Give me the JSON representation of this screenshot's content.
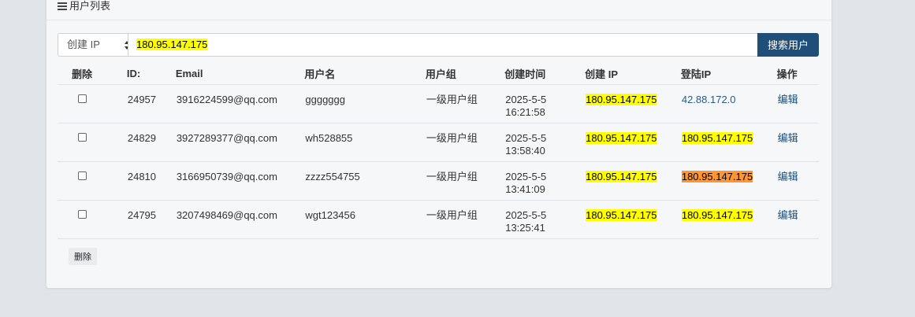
{
  "panel": {
    "title": "用户列表",
    "icon": "list-icon"
  },
  "search": {
    "field_selected": "创建 IP",
    "value": "180.95.147.175",
    "button_label": "搜索用户"
  },
  "table": {
    "headers": [
      "删除",
      "ID:",
      "Email",
      "用户名",
      "用户组",
      "创建时间",
      "创建 IP",
      "登陆IP",
      "操作"
    ],
    "rows": [
      {
        "id": "24957",
        "email": "3916224599@qq.com",
        "username": "ggggggg",
        "group": "一级用户组",
        "date": "2025-5-5",
        "time": "16:21:58",
        "create_ip": "180.95.147.175",
        "login_ip": "42.88.172.0",
        "login_ip_style": "link",
        "op": "编辑"
      },
      {
        "id": "24829",
        "email": "3927289377@qq.com",
        "username": "wh528855",
        "group": "一级用户组",
        "date": "2025-5-5",
        "time": "13:58:40",
        "create_ip": "180.95.147.175",
        "login_ip": "180.95.147.175",
        "login_ip_style": "yellow",
        "op": "编辑"
      },
      {
        "id": "24810",
        "email": "3166950739@qq.com",
        "username": "zzzz554755",
        "group": "一级用户组",
        "date": "2025-5-5",
        "time": "13:41:09",
        "create_ip": "180.95.147.175",
        "login_ip": "180.95.147.175",
        "login_ip_style": "orange",
        "op": "编辑"
      },
      {
        "id": "24795",
        "email": "3207498469@qq.com",
        "username": "wgt123456",
        "group": "一级用户组",
        "date": "2025-5-5",
        "time": "13:25:41",
        "create_ip": "180.95.147.175",
        "login_ip": "180.95.147.175",
        "login_ip_style": "yellow",
        "op": "编辑"
      }
    ]
  },
  "footer": {
    "delete_label": "删除"
  },
  "colors": {
    "highlight": "#ffff00",
    "highlight_current": "#ff9632",
    "primary": "#1f4e79"
  }
}
